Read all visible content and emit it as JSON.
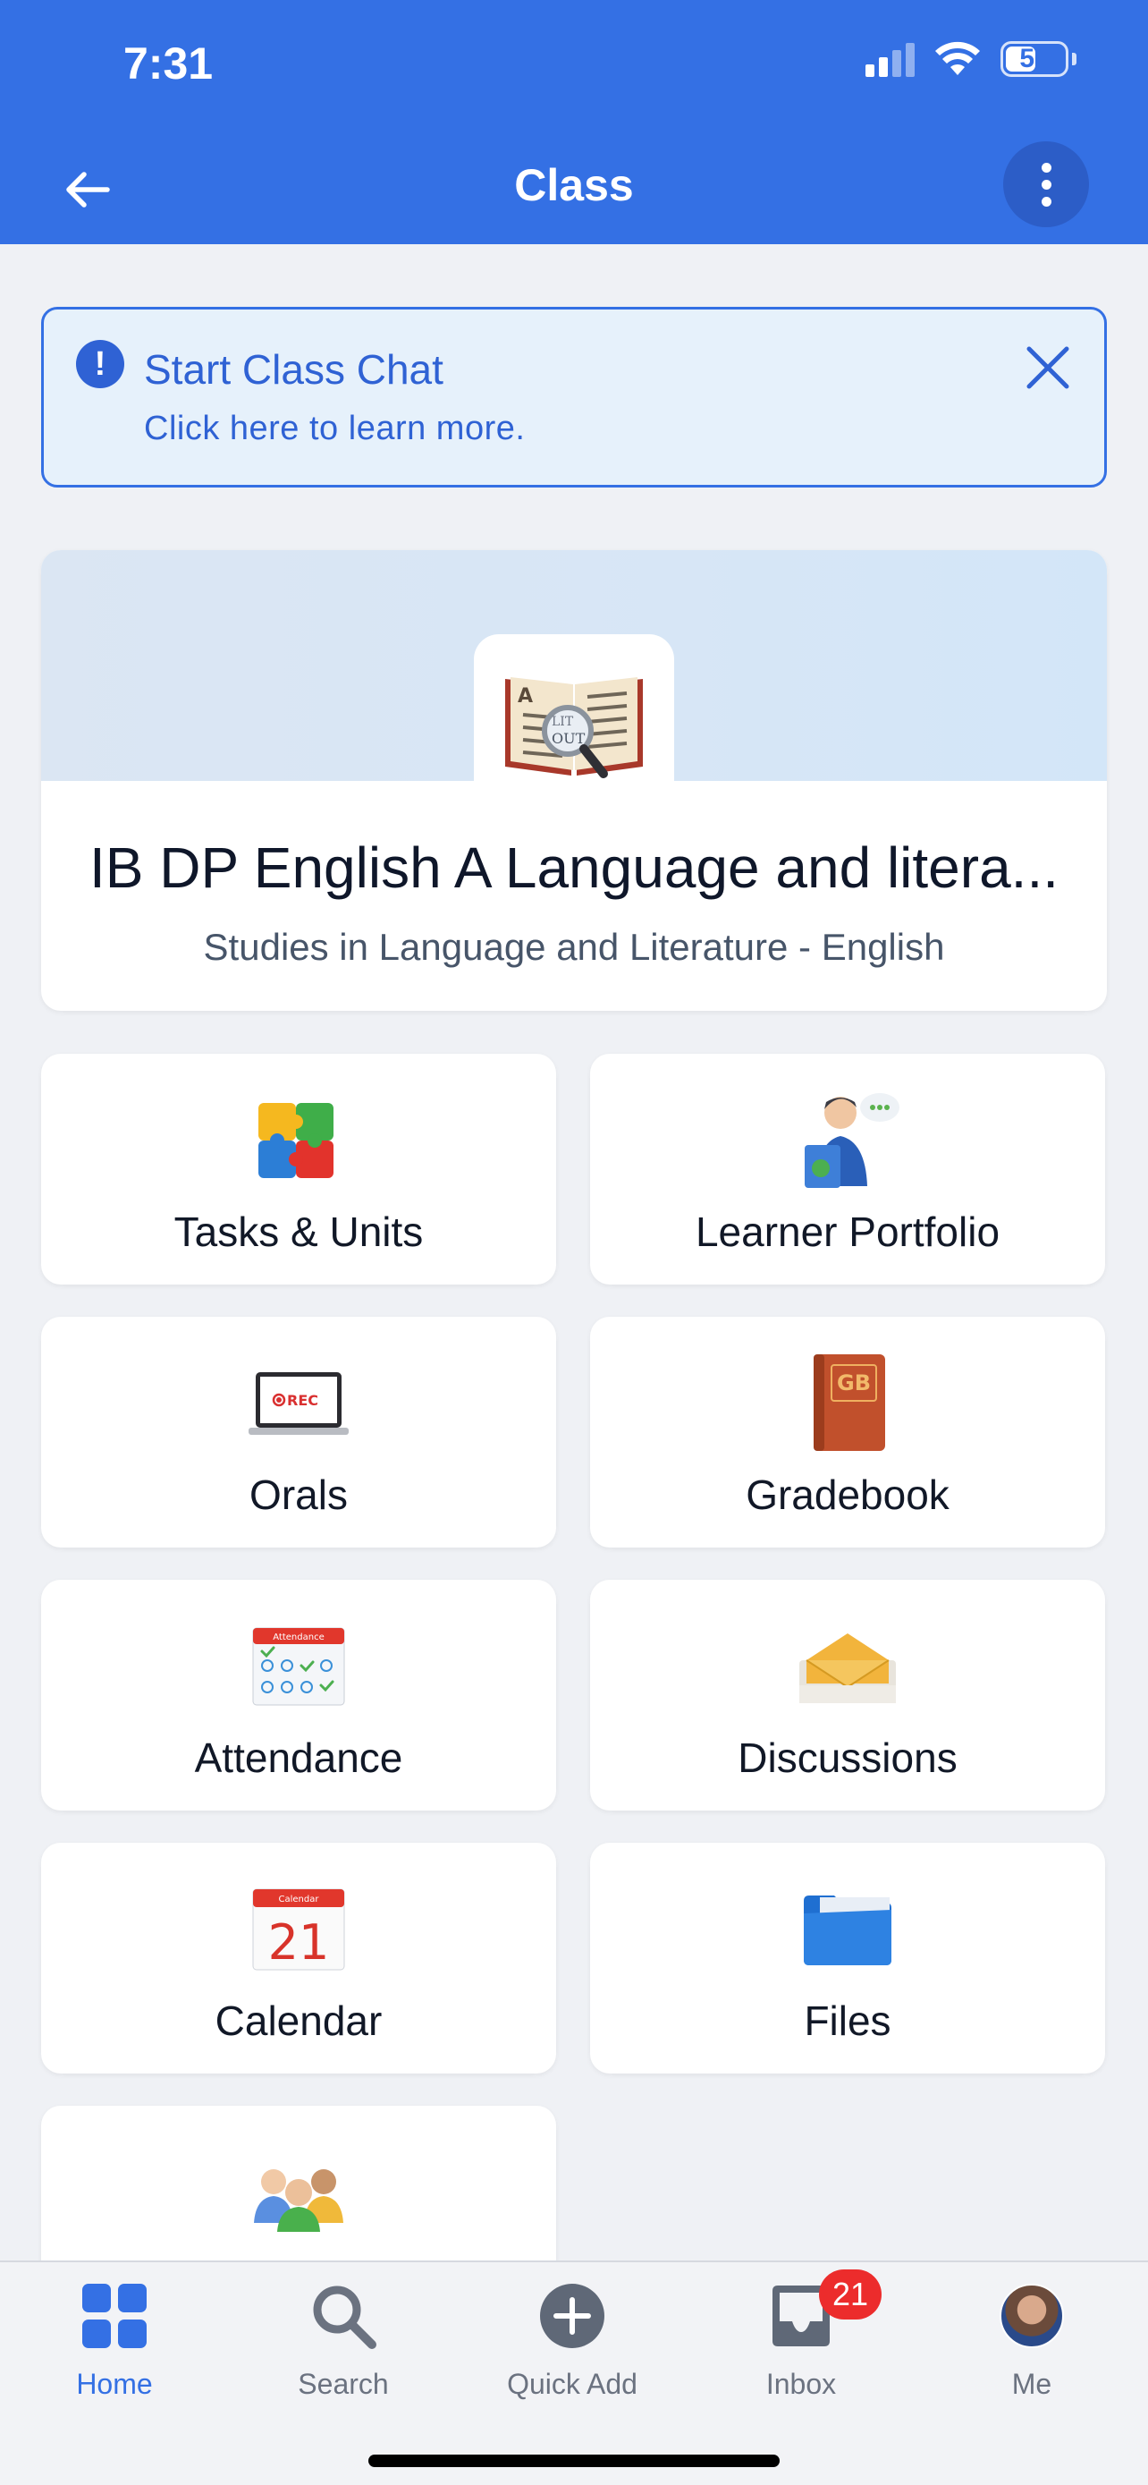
{
  "status_bar": {
    "time": "7:31",
    "battery": "51",
    "battery_level": 0.51
  },
  "app_bar": {
    "title": "Class"
  },
  "banner": {
    "title": "Start Class Chat",
    "subtitle": "Click here to learn more."
  },
  "class": {
    "name": "IB DP English A Language and litera...",
    "subject": "Studies in Language and Literature - English",
    "book_word_1": "LIT",
    "book_word_2": "OUT",
    "book_letter": "A"
  },
  "tiles": [
    {
      "label": "Tasks & Units",
      "icon": "puzzle-icon"
    },
    {
      "label": "Learner Portfolio",
      "icon": "learner-reading-icon"
    },
    {
      "label": "Orals",
      "icon": "laptop-rec-icon",
      "icon_text": "REC"
    },
    {
      "label": "Gradebook",
      "icon": "gradebook-book-icon",
      "icon_text": "GB"
    },
    {
      "label": "Attendance",
      "icon": "attendance-calendar-icon",
      "icon_text": "Attendance"
    },
    {
      "label": "Discussions",
      "icon": "envelope-icon"
    },
    {
      "label": "Calendar",
      "icon": "calendar-icon",
      "icon_text": "Calendar",
      "icon_number": "21"
    },
    {
      "label": "Files",
      "icon": "folder-icon"
    },
    {
      "label": "",
      "icon": "people-group-icon"
    }
  ],
  "tab_bar": {
    "items": [
      {
        "label": "Home",
        "icon": "home-grid-icon",
        "active": true
      },
      {
        "label": "Search",
        "icon": "search-icon"
      },
      {
        "label": "Quick Add",
        "icon": "plus-circle-icon"
      },
      {
        "label": "Inbox",
        "icon": "inbox-icon",
        "badge": "21"
      },
      {
        "label": "Me",
        "icon": "avatar"
      }
    ]
  },
  "colors": {
    "primary": "#3470e4",
    "background": "#eff1f5",
    "badge": "#ec2c2c"
  }
}
